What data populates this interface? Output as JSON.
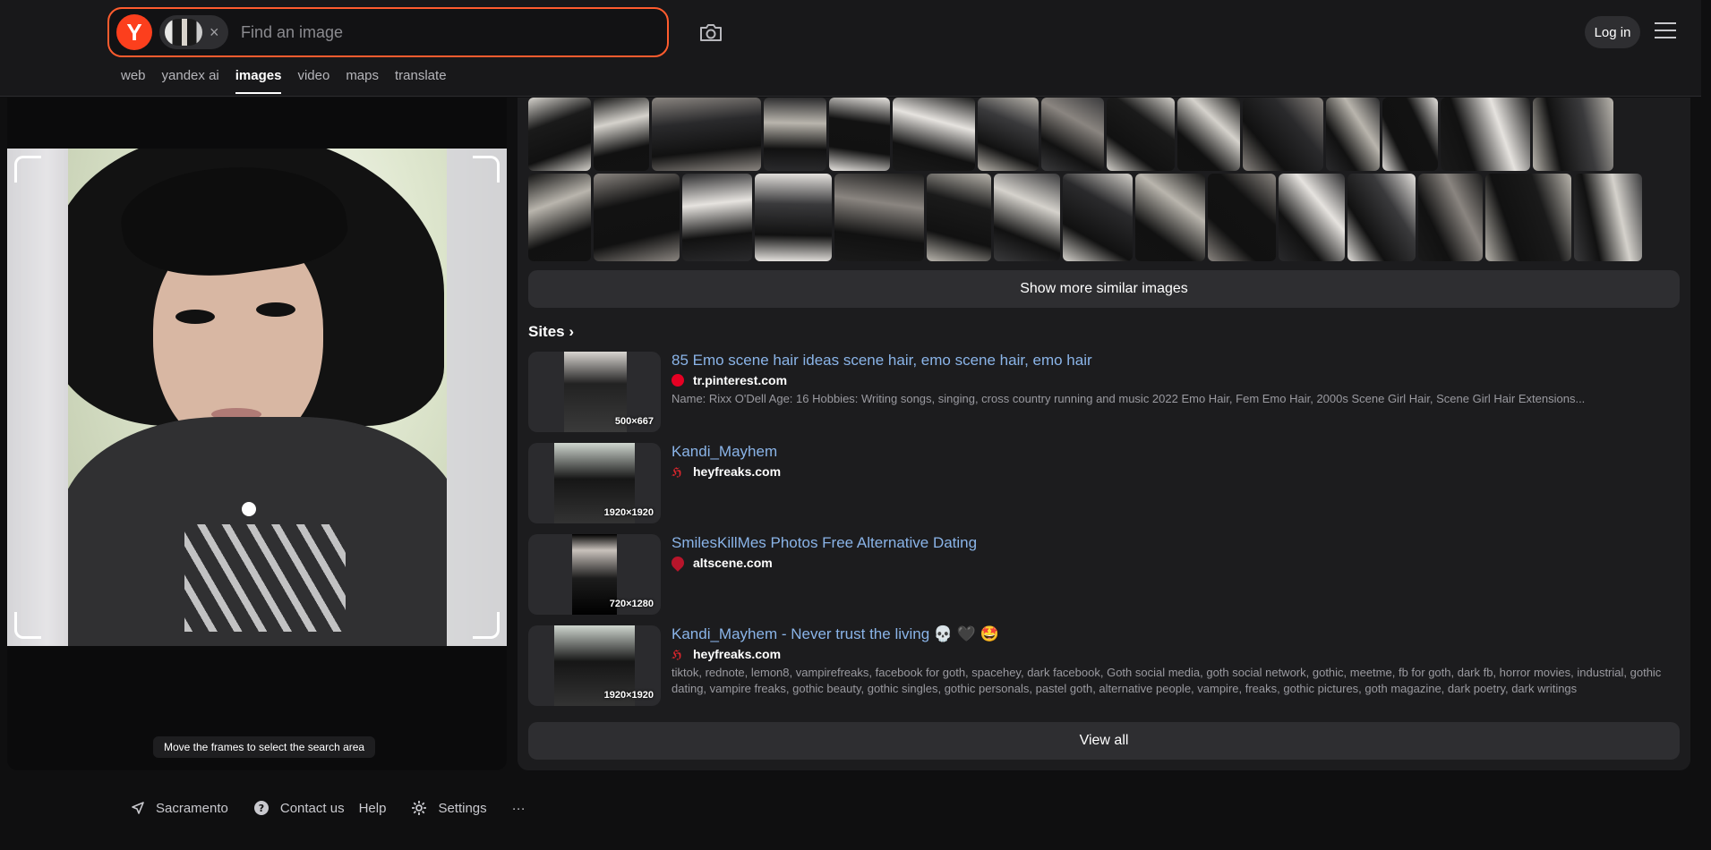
{
  "header": {
    "logo_letter": "Y",
    "search_placeholder": "Find an image",
    "clear_symbol": "×",
    "login_label": "Log in"
  },
  "nav": {
    "tabs": [
      {
        "label": "web"
      },
      {
        "label": "yandex ai"
      },
      {
        "label": "images",
        "active": true
      },
      {
        "label": "video"
      },
      {
        "label": "maps"
      },
      {
        "label": "translate"
      }
    ]
  },
  "preview": {
    "hint": "Move the frames to select the search area"
  },
  "similar": {
    "show_more_label": "Show more similar images"
  },
  "sites": {
    "heading": "Sites",
    "heading_arrow": "›",
    "items": [
      {
        "title": "85 Emo scene hair ideas scene hair, emo scene hair, emo hair",
        "host": "tr.pinterest.com",
        "size": "500×667",
        "desc": "Name: Rixx O'Dell Age: 16 Hobbies: Writing songs, singing, cross country running and music 2022 Emo Hair, Fem Emo Hair, 2000s Scene Girl Hair, Scene Girl Hair Extensions..."
      },
      {
        "title": "Kandi_Mayhem",
        "host": "heyfreaks.com",
        "size": "1920×1920",
        "desc": ""
      },
      {
        "title": "SmilesKillMes Photos Free Alternative Dating",
        "host": "altscene.com",
        "size": "720×1280",
        "desc": ""
      },
      {
        "title": "Kandi_Mayhem - Never trust the living 💀 🖤 🤩",
        "host": "heyfreaks.com",
        "size": "1920×1920",
        "desc": "tiktok, rednote, lemon8, vampirefreaks, facebook for goth, spacehey, dark facebook, Goth social media, goth social network, gothic, meetme, fb for goth, dark fb, horror movies, industrial, gothic dating, vampire freaks, gothic beauty, gothic singles, gothic personals, pastel goth, alternative people, vampire, freaks, gothic pictures, goth magazine, dark poetry, dark writings"
      }
    ],
    "view_all_label": "View all"
  },
  "footer": {
    "location": "Sacramento",
    "contact": "Contact us",
    "help": "Help",
    "settings": "Settings",
    "more": "···"
  },
  "colors": {
    "accent": "#fc3f1d",
    "search_border": "#ff5c2e",
    "link": "#8ab4e8"
  }
}
